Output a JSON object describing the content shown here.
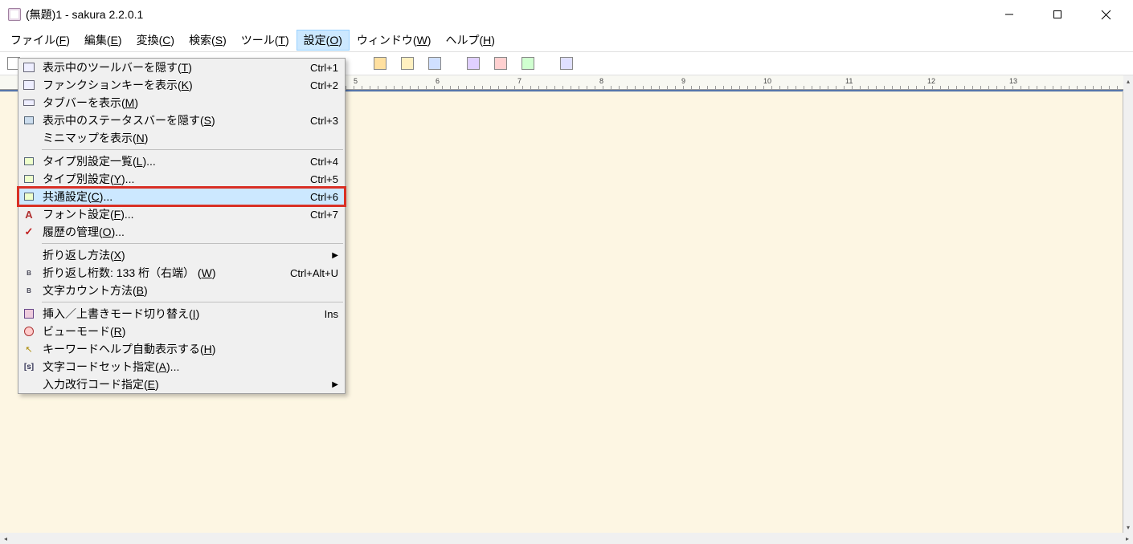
{
  "window": {
    "title": "(無題)1 - sakura 2.2.0.1"
  },
  "menubar": [
    {
      "label": "ファイル",
      "accel": "F"
    },
    {
      "label": "編集",
      "accel": "E"
    },
    {
      "label": "変換",
      "accel": "C"
    },
    {
      "label": "検索",
      "accel": "S"
    },
    {
      "label": "ツール",
      "accel": "T"
    },
    {
      "label": "設定",
      "accel": "O",
      "open": true
    },
    {
      "label": "ウィンドウ",
      "accel": "W"
    },
    {
      "label": "ヘルプ",
      "accel": "H"
    }
  ],
  "dropdown": {
    "items": [
      {
        "label": "表示中のツールバーを隠す",
        "accel": "T",
        "shortcut": "Ctrl+1",
        "icon": "box"
      },
      {
        "label": "ファンクションキーを表示",
        "accel": "K",
        "shortcut": "Ctrl+2",
        "icon": "box"
      },
      {
        "label": "タブバーを表示",
        "accel": "M",
        "shortcut": "",
        "icon": "tab"
      },
      {
        "label": "表示中のステータスバーを隠す",
        "accel": "S",
        "shortcut": "Ctrl+3",
        "icon": "sq"
      },
      {
        "label": "ミニマップを表示",
        "accel": "N",
        "shortcut": "",
        "icon": ""
      },
      {
        "sep": true
      },
      {
        "label": "タイプ別設定一覧",
        "accel": "L",
        "suffix": "...",
        "shortcut": "Ctrl+4",
        "icon": "cfg"
      },
      {
        "label": "タイプ別設定",
        "accel": "Y",
        "suffix": "...",
        "shortcut": "Ctrl+5",
        "icon": "cfg"
      },
      {
        "label": "共通設定",
        "accel": "C",
        "suffix": "...",
        "shortcut": "Ctrl+6",
        "icon": "cfg",
        "highlighted": true
      },
      {
        "label": "フォント設定",
        "accel": "F",
        "suffix": "...",
        "shortcut": "Ctrl+7",
        "icon": "font"
      },
      {
        "label": "履歴の管理",
        "accel": "O",
        "suffix": "...",
        "shortcut": "",
        "icon": "check"
      },
      {
        "sep": true
      },
      {
        "label": "折り返し方法",
        "accel": "X",
        "shortcut": "",
        "icon": "",
        "submenu": true
      },
      {
        "label": "折り返し桁数: 133 桁（右端）",
        "accel": "W",
        "shortcut": "Ctrl+Alt+U",
        "icon": "byte"
      },
      {
        "label": "文字カウント方法",
        "accel": "B",
        "shortcut": "",
        "icon": "byte"
      },
      {
        "sep": true
      },
      {
        "label": "挿入／上書きモード切り替え",
        "accel": "I",
        "shortcut": "Ins",
        "icon": "ins"
      },
      {
        "label": "ビューモード",
        "accel": "R",
        "shortcut": "",
        "icon": "ro"
      },
      {
        "label": "キーワードヘルプ自動表示する",
        "accel": "H",
        "shortcut": "",
        "icon": "arrow"
      },
      {
        "label": "文字コードセット指定",
        "accel": "A",
        "suffix": "...",
        "shortcut": "",
        "icon": "code"
      },
      {
        "label": "入力改行コード指定",
        "accel": "E",
        "shortcut": "",
        "icon": "",
        "submenu": true
      }
    ]
  },
  "ruler": {
    "marks": [
      "5",
      "6",
      "7",
      "8",
      "9",
      "10",
      "11",
      "12",
      "13"
    ]
  }
}
